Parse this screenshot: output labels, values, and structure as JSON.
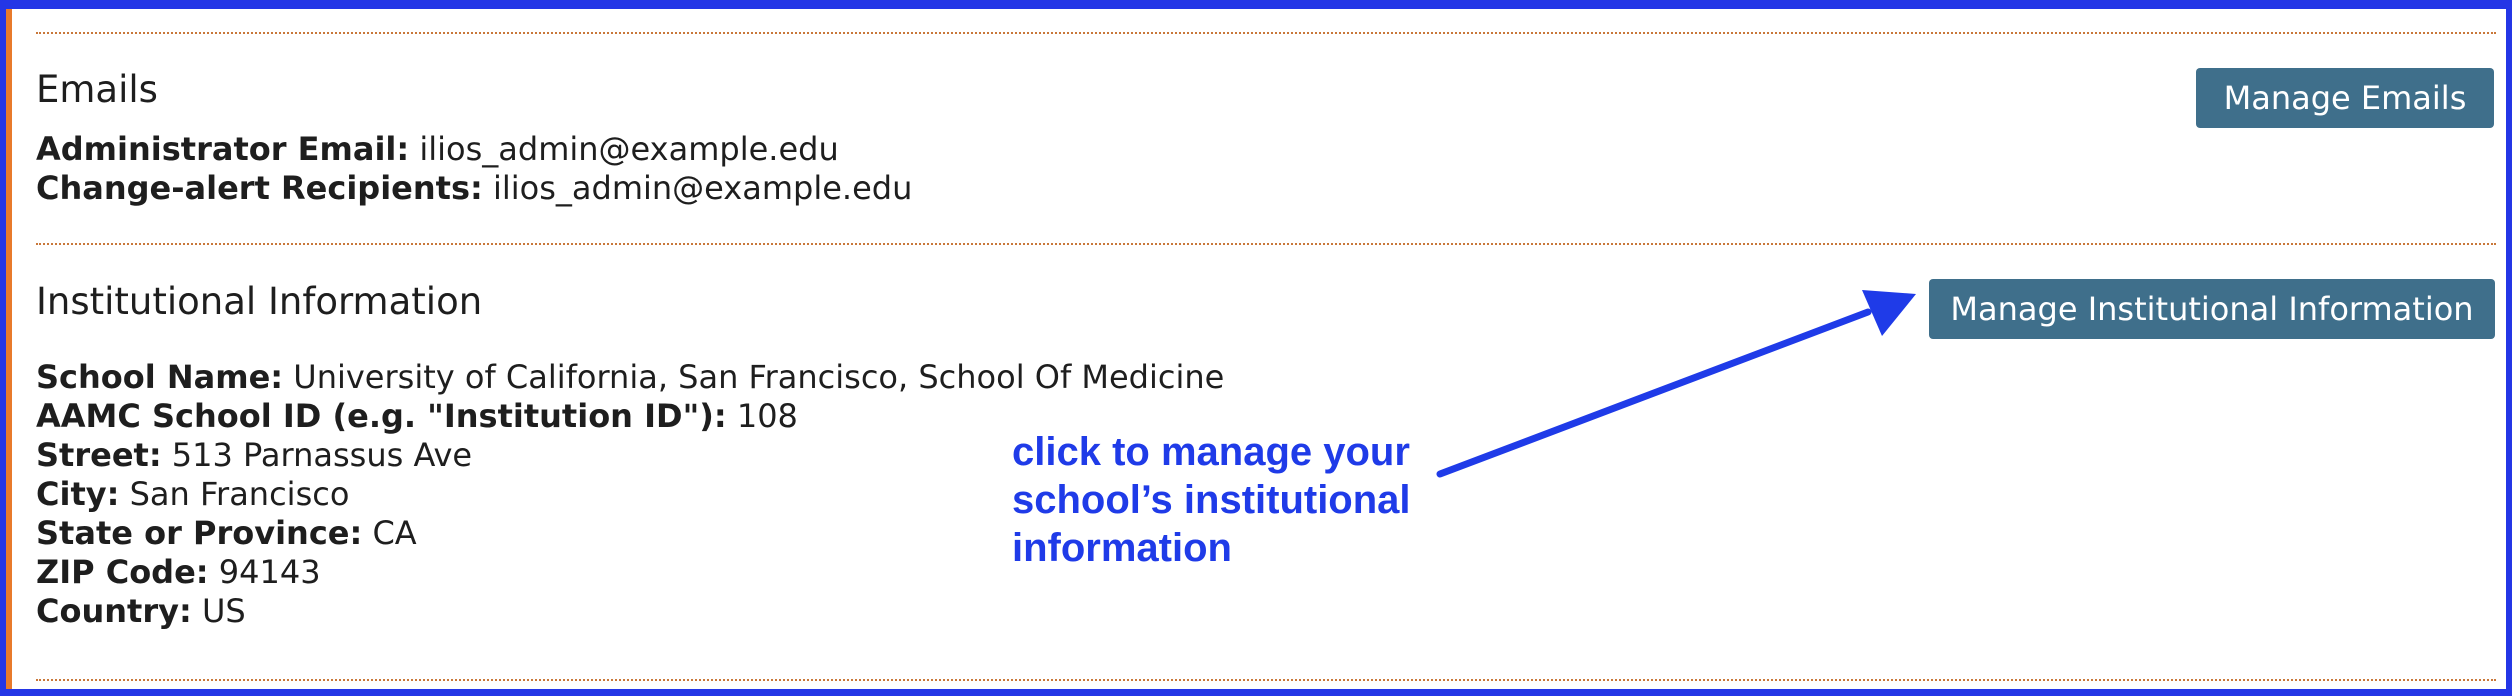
{
  "emails": {
    "title": "Emails",
    "manage_button": "Manage Emails",
    "fields": [
      {
        "label": "Administrator Email:",
        "value": "ilios_admin@example.edu"
      },
      {
        "label": "Change-alert Recipients:",
        "value": "ilios_admin@example.edu"
      }
    ]
  },
  "institution": {
    "title": "Institutional Information",
    "manage_button": "Manage Institutional Information",
    "fields": [
      {
        "label": "School Name:",
        "value": "University of California, San Francisco, School Of Medicine"
      },
      {
        "label": "AAMC School ID (e.g. \"Institution ID\"):",
        "value": "108"
      },
      {
        "label": "Street:",
        "value": "513 Parnassus Ave"
      },
      {
        "label": "City:",
        "value": "San Francisco"
      },
      {
        "label": "State or Province:",
        "value": "CA"
      },
      {
        "label": "ZIP Code:",
        "value": "94143"
      },
      {
        "label": "Country:",
        "value": "US"
      }
    ]
  },
  "annotation": {
    "lines": [
      "click to manage your",
      "school’s institutional",
      "information"
    ]
  },
  "colors": {
    "button_bg": "#3f6f8b",
    "annotation": "#1f3be8",
    "frame": "#2436e6",
    "divider": "#c9783a"
  }
}
